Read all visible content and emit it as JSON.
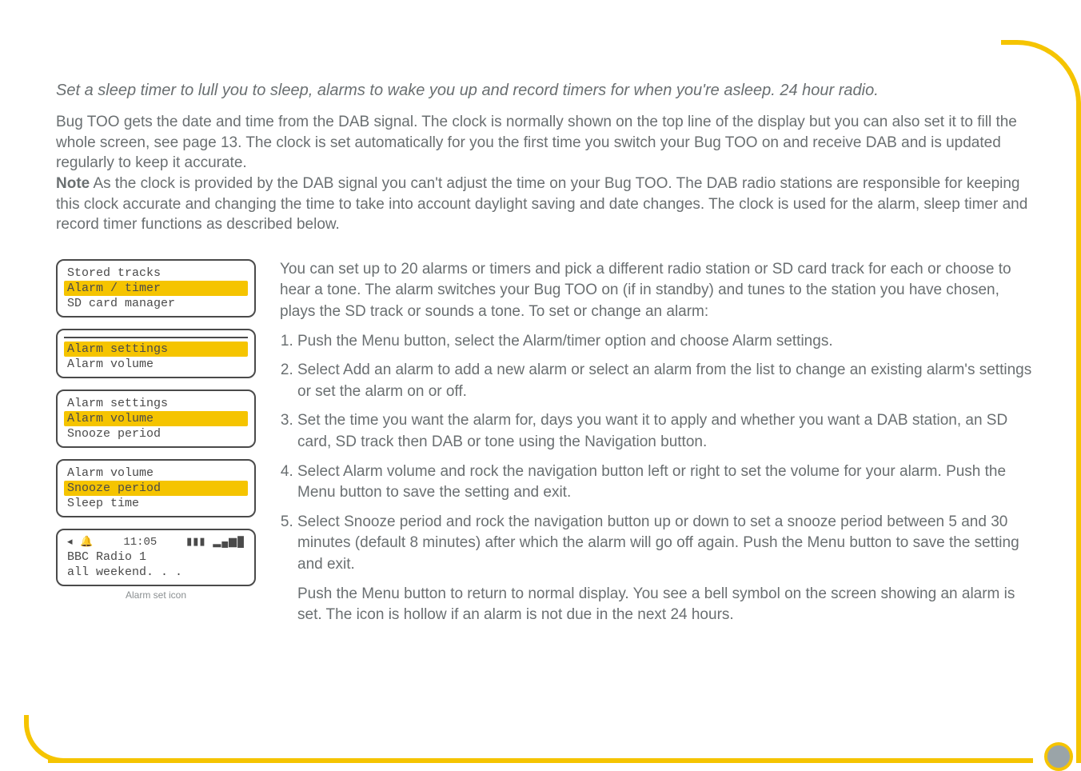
{
  "tagline": "Set a sleep timer to lull you to sleep, alarms to wake you up and record timers for when you're asleep. 24 hour radio.",
  "intro_p1": "Bug TOO gets the date and time from the DAB signal. The clock is normally shown on the top line of the display but you can also set it to fill the whole screen, see page 13. The clock is set automatically for you the first time you switch your Bug TOO on and receive DAB and is updated regularly to keep it accurate.",
  "intro_note_label": "Note",
  "intro_p2": " As the clock is provided by the DAB signal you can't adjust the time on your Bug TOO. The DAB radio stations are responsible for keeping this clock accurate and changing the time to take into account daylight saving and date changes. The clock is used for the alarm, sleep timer and record timer functions as described below.",
  "lcd1": {
    "r1": "Stored tracks",
    "r2": "Alarm / timer",
    "r3": "SD card manager"
  },
  "lcd2": {
    "r1": "Alarm settings",
    "r2": "Alarm volume"
  },
  "lcd3": {
    "r1": "Alarm settings",
    "r2": "Alarm volume",
    "r3": "Snooze period"
  },
  "lcd4": {
    "r1": "Alarm volume",
    "r2": "Snooze period",
    "r3": "Sleep time"
  },
  "lcd5": {
    "icons_left": "◂ 🔔",
    "time": "11:05",
    "icons_right": "▮▮▮ ▂▄▆█",
    "r2": "BBC Radio 1",
    "r3": "all weekend. . ."
  },
  "caption": "Alarm set icon",
  "body_intro": "You can set up to 20 alarms or timers and pick a different radio station or SD card track for each or choose to hear a tone. The alarm switches your Bug TOO on (if in standby) and tunes to the station you have chosen, plays the SD track or sounds a tone. To set or change an alarm:",
  "steps": {
    "s1": "Push the Menu button, select the Alarm/timer option and choose Alarm settings.",
    "s2": "Select Add an alarm to add a new alarm or select an alarm from the list to change an existing alarm's settings or set the alarm on or off.",
    "s3": "Set the time you want the alarm for, days you want it to apply and whether you want a DAB station, an SD card, SD track then DAB or tone using the Navigation button.",
    "s4": "Select Alarm volume and rock the navigation button left or right to set the volume for your alarm. Push the Menu button to save the setting and exit.",
    "s5": "Select Snooze period and rock the navigation button up or down to set a snooze period between 5 and 30 minutes (default 8 minutes) after which the alarm will go off again. Push the Menu button to save the setting and exit."
  },
  "body_outro": "Push the Menu button to return to normal display. You see a bell symbol on the screen showing an alarm is set. The icon is hollow if an alarm is not due in the next 24 hours."
}
